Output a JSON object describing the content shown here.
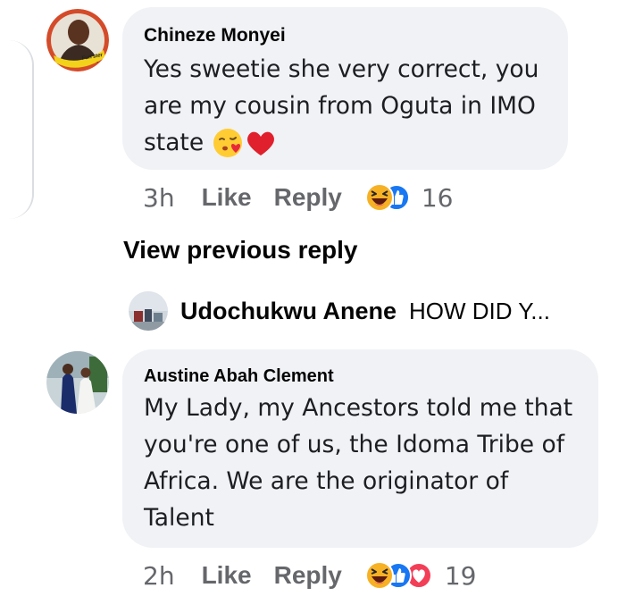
{
  "comments": [
    {
      "author": "Chineze Monyei",
      "lines": [
        "Yes sweetie she very correct, you",
        "are my cousin from Oguta in IMO",
        "state"
      ],
      "time": "3h",
      "like_label": "Like",
      "reply_label": "Reply",
      "reaction_icons": [
        "haha-icon",
        "like-icon"
      ],
      "reaction_count": "16"
    },
    {
      "author": "Austine Abah Clement",
      "lines": [
        "My Lady, my Ancestors told me that",
        "you're one of us, the Idoma Tribe of",
        "Africa. We are the originator of",
        "Talent"
      ],
      "time": "2h",
      "like_label": "Like",
      "reply_label": "Reply",
      "reaction_icons": [
        "haha-icon",
        "like-icon",
        "love-icon"
      ],
      "reaction_count": "19"
    }
  ],
  "view_previous_label": "View previous reply",
  "collapsed_reply": {
    "author": "Udochukwu Anene",
    "preview": "HOW DID Y..."
  },
  "colors": {
    "bubble": "#f0f2f5",
    "meta": "#65676b",
    "like_blue": "#1877f2",
    "love_red": "#f33e58",
    "haha_yellow": "#f7b125"
  },
  "avatar_badge_text": "Fun'ster",
  "emoji": [
    "kissing-heart-emoji",
    "red-heart-emoji"
  ]
}
